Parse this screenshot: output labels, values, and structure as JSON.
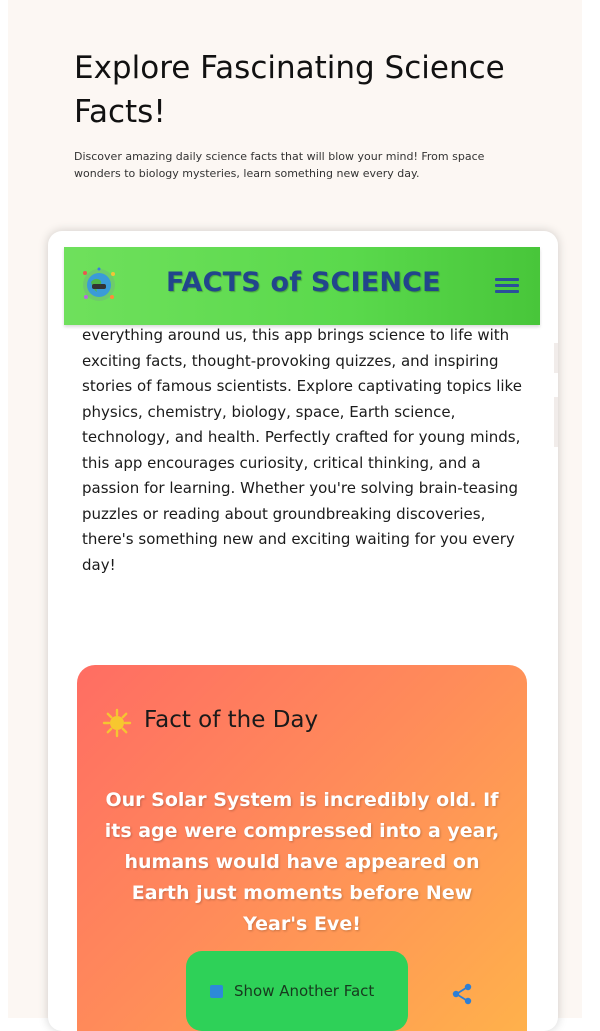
{
  "hero": {
    "title": "Explore Fascinating Science Facts!",
    "description": "Discover amazing daily science facts that will blow your mind! From space wonders to biology mysteries, learn something new every day."
  },
  "app": {
    "title": "FACTS of SCIENCE",
    "logo_icon": "earth-globe-icon",
    "menu_icon": "hamburger-menu-icon"
  },
  "intro": {
    "text": "everything around us, this app brings science to life with exciting facts, thought-provoking quizzes, and inspiring stories of famous scientists. Explore captivating topics like physics, chemistry, biology, space, Earth science, technology, and health. Perfectly crafted for young minds, this app encourages curiosity, critical thinking, and a passion for learning. Whether you're solving brain-teasing puzzles or reading about groundbreaking discoveries, there's something new and exciting waiting for you every day!"
  },
  "fact_of_day": {
    "heading": "Fact of the Day",
    "icon": "sun-icon",
    "text": "Our Solar System is incredibly old. If its age were compressed into a year, humans would have appeared on Earth just moments before New Year's Eve!",
    "button_label": "Show Another Fact",
    "share_icon": "share-icon"
  },
  "colors": {
    "header_green": "#5ad94c",
    "title_blue": "#22458c",
    "card_gradient_start": "#ff6d63",
    "card_gradient_end": "#ffb44a",
    "button_green": "#2ed158",
    "page_bg": "#fcf7f3"
  }
}
